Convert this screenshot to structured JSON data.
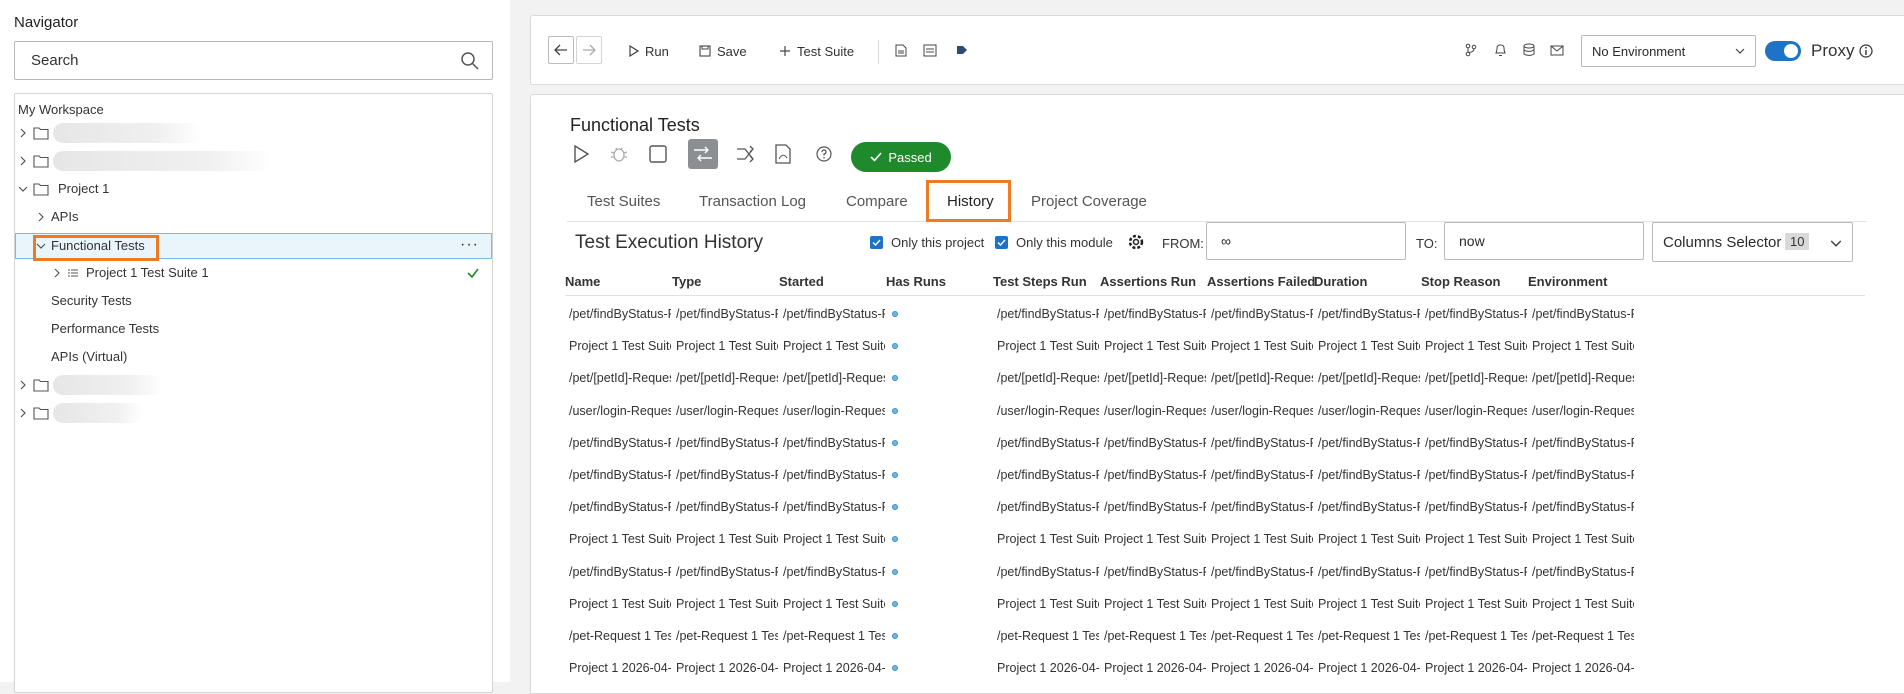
{
  "navigator": {
    "title": "Navigator",
    "search_placeholder": "Search",
    "workspace_label": "My Workspace",
    "items": [
      {
        "label": "Project 1"
      },
      {
        "label": "APIs"
      },
      {
        "label": "Functional Tests"
      },
      {
        "label": "Project 1 Test Suite 1"
      },
      {
        "label": "Security Tests"
      },
      {
        "label": "Performance Tests"
      },
      {
        "label": "APIs (Virtual)"
      }
    ],
    "more_label": "···"
  },
  "toolbar": {
    "run_label": "Run",
    "save_label": "Save",
    "test_suite_label": "Test Suite",
    "environment": "No Environment",
    "proxy_label": "Proxy",
    "proxy_enabled": true
  },
  "main": {
    "title": "Functional Tests",
    "status_badge": "Passed",
    "tabs": [
      {
        "label": "Test Suites"
      },
      {
        "label": "Transaction Log"
      },
      {
        "label": "Compare"
      },
      {
        "label": "History"
      },
      {
        "label": "Project Coverage"
      }
    ],
    "active_tab": "History",
    "history": {
      "title": "Test Execution History",
      "only_project_label": "Only this project",
      "only_module_label": "Only this module",
      "from_label": "FROM:",
      "from_value": "∞",
      "to_label": "TO:",
      "to_value": "now",
      "columns_selector_label": "Columns Selector",
      "columns_count": "10"
    },
    "table": {
      "columns": [
        "Name",
        "Type",
        "Started",
        "Has Runs",
        "Test Steps Run",
        "Assertions Run",
        "Assertions Failed",
        "Duration",
        "Stop Reason",
        "Environment"
      ],
      "rows": [
        "/pet/findByStatus-R...",
        "Project 1 Test Suite ...",
        "/pet/[petId]-Request...",
        "/user/login-Request...",
        "/pet/findByStatus-R...",
        "/pet/findByStatus-R...",
        "/pet/findByStatus-R...",
        "Project 1 Test Suite ...",
        "/pet/findByStatus-R...",
        "Project 1 Test Suite ...",
        "/pet-Request 1 Test ...",
        "Project 1 2026-04-..."
      ]
    }
  },
  "colors": {
    "accent": "#1f73c7",
    "passed": "#1e8a2b",
    "highlight": "#ee7a22",
    "selected_row": "#eaf4fb"
  }
}
